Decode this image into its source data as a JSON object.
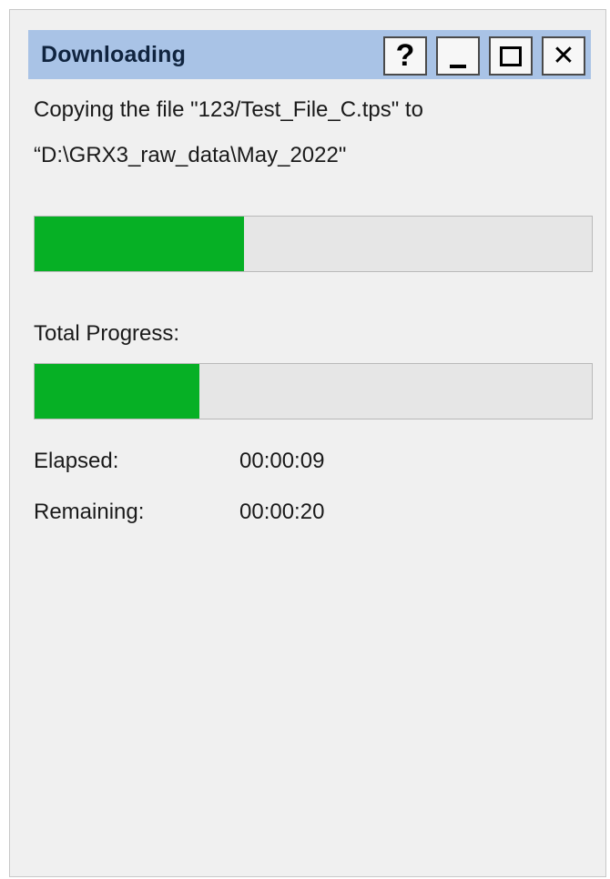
{
  "window": {
    "title": "Downloading",
    "buttons": {
      "help": "?",
      "minimize": "_",
      "maximize": "□",
      "close": "✕"
    }
  },
  "message": {
    "line1": "Copying the file \"123/Test_File_C.tps\" to",
    "line2": "“D:\\GRX3_raw_data\\May_2022\""
  },
  "progress": {
    "file_fraction": 0.375,
    "total_label": "Total Progress:",
    "total_fraction": 0.295
  },
  "times": {
    "elapsed_label": "Elapsed:",
    "elapsed_value": "00:00:09",
    "remaining_label": "Remaining:",
    "remaining_value": "00:00:20"
  },
  "colors": {
    "titlebar": "#a9c3e6",
    "progress_fill": "#06b025",
    "progress_track": "#e6e6e6",
    "window_bg": "#f0f0f0"
  }
}
